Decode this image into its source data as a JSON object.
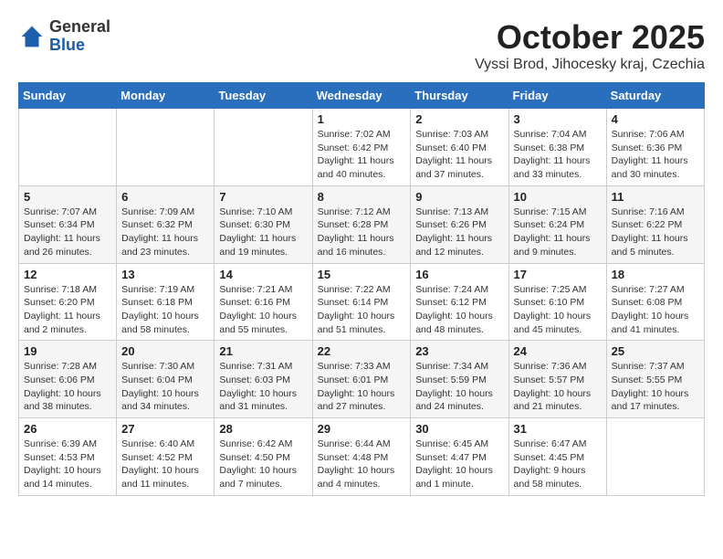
{
  "header": {
    "logo_general": "General",
    "logo_blue": "Blue",
    "month_title": "October 2025",
    "subtitle": "Vyssi Brod, Jihocesky kraj, Czechia"
  },
  "days_of_week": [
    "Sunday",
    "Monday",
    "Tuesday",
    "Wednesday",
    "Thursday",
    "Friday",
    "Saturday"
  ],
  "weeks": [
    [
      {
        "day": "",
        "detail": ""
      },
      {
        "day": "",
        "detail": ""
      },
      {
        "day": "",
        "detail": ""
      },
      {
        "day": "1",
        "detail": "Sunrise: 7:02 AM\nSunset: 6:42 PM\nDaylight: 11 hours\nand 40 minutes."
      },
      {
        "day": "2",
        "detail": "Sunrise: 7:03 AM\nSunset: 6:40 PM\nDaylight: 11 hours\nand 37 minutes."
      },
      {
        "day": "3",
        "detail": "Sunrise: 7:04 AM\nSunset: 6:38 PM\nDaylight: 11 hours\nand 33 minutes."
      },
      {
        "day": "4",
        "detail": "Sunrise: 7:06 AM\nSunset: 6:36 PM\nDaylight: 11 hours\nand 30 minutes."
      }
    ],
    [
      {
        "day": "5",
        "detail": "Sunrise: 7:07 AM\nSunset: 6:34 PM\nDaylight: 11 hours\nand 26 minutes."
      },
      {
        "day": "6",
        "detail": "Sunrise: 7:09 AM\nSunset: 6:32 PM\nDaylight: 11 hours\nand 23 minutes."
      },
      {
        "day": "7",
        "detail": "Sunrise: 7:10 AM\nSunset: 6:30 PM\nDaylight: 11 hours\nand 19 minutes."
      },
      {
        "day": "8",
        "detail": "Sunrise: 7:12 AM\nSunset: 6:28 PM\nDaylight: 11 hours\nand 16 minutes."
      },
      {
        "day": "9",
        "detail": "Sunrise: 7:13 AM\nSunset: 6:26 PM\nDaylight: 11 hours\nand 12 minutes."
      },
      {
        "day": "10",
        "detail": "Sunrise: 7:15 AM\nSunset: 6:24 PM\nDaylight: 11 hours\nand 9 minutes."
      },
      {
        "day": "11",
        "detail": "Sunrise: 7:16 AM\nSunset: 6:22 PM\nDaylight: 11 hours\nand 5 minutes."
      }
    ],
    [
      {
        "day": "12",
        "detail": "Sunrise: 7:18 AM\nSunset: 6:20 PM\nDaylight: 11 hours\nand 2 minutes."
      },
      {
        "day": "13",
        "detail": "Sunrise: 7:19 AM\nSunset: 6:18 PM\nDaylight: 10 hours\nand 58 minutes."
      },
      {
        "day": "14",
        "detail": "Sunrise: 7:21 AM\nSunset: 6:16 PM\nDaylight: 10 hours\nand 55 minutes."
      },
      {
        "day": "15",
        "detail": "Sunrise: 7:22 AM\nSunset: 6:14 PM\nDaylight: 10 hours\nand 51 minutes."
      },
      {
        "day": "16",
        "detail": "Sunrise: 7:24 AM\nSunset: 6:12 PM\nDaylight: 10 hours\nand 48 minutes."
      },
      {
        "day": "17",
        "detail": "Sunrise: 7:25 AM\nSunset: 6:10 PM\nDaylight: 10 hours\nand 45 minutes."
      },
      {
        "day": "18",
        "detail": "Sunrise: 7:27 AM\nSunset: 6:08 PM\nDaylight: 10 hours\nand 41 minutes."
      }
    ],
    [
      {
        "day": "19",
        "detail": "Sunrise: 7:28 AM\nSunset: 6:06 PM\nDaylight: 10 hours\nand 38 minutes."
      },
      {
        "day": "20",
        "detail": "Sunrise: 7:30 AM\nSunset: 6:04 PM\nDaylight: 10 hours\nand 34 minutes."
      },
      {
        "day": "21",
        "detail": "Sunrise: 7:31 AM\nSunset: 6:03 PM\nDaylight: 10 hours\nand 31 minutes."
      },
      {
        "day": "22",
        "detail": "Sunrise: 7:33 AM\nSunset: 6:01 PM\nDaylight: 10 hours\nand 27 minutes."
      },
      {
        "day": "23",
        "detail": "Sunrise: 7:34 AM\nSunset: 5:59 PM\nDaylight: 10 hours\nand 24 minutes."
      },
      {
        "day": "24",
        "detail": "Sunrise: 7:36 AM\nSunset: 5:57 PM\nDaylight: 10 hours\nand 21 minutes."
      },
      {
        "day": "25",
        "detail": "Sunrise: 7:37 AM\nSunset: 5:55 PM\nDaylight: 10 hours\nand 17 minutes."
      }
    ],
    [
      {
        "day": "26",
        "detail": "Sunrise: 6:39 AM\nSunset: 4:53 PM\nDaylight: 10 hours\nand 14 minutes."
      },
      {
        "day": "27",
        "detail": "Sunrise: 6:40 AM\nSunset: 4:52 PM\nDaylight: 10 hours\nand 11 minutes."
      },
      {
        "day": "28",
        "detail": "Sunrise: 6:42 AM\nSunset: 4:50 PM\nDaylight: 10 hours\nand 7 minutes."
      },
      {
        "day": "29",
        "detail": "Sunrise: 6:44 AM\nSunset: 4:48 PM\nDaylight: 10 hours\nand 4 minutes."
      },
      {
        "day": "30",
        "detail": "Sunrise: 6:45 AM\nSunset: 4:47 PM\nDaylight: 10 hours\nand 1 minute."
      },
      {
        "day": "31",
        "detail": "Sunrise: 6:47 AM\nSunset: 4:45 PM\nDaylight: 9 hours\nand 58 minutes."
      },
      {
        "day": "",
        "detail": ""
      }
    ]
  ]
}
